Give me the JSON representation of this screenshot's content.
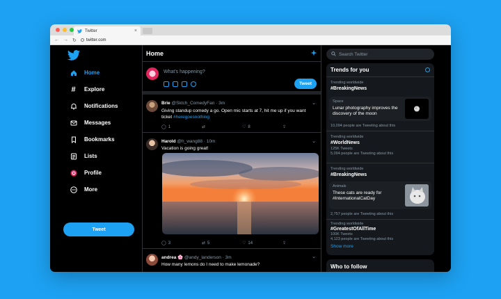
{
  "browser": {
    "tab_title": "Twitter",
    "url": "twitter.com",
    "dot_colors": [
      "#ff5f57",
      "#febc2e",
      "#28c840"
    ]
  },
  "nav": {
    "items": [
      {
        "label": "Home",
        "icon": "home-icon"
      },
      {
        "label": "Explore",
        "icon": "hashtag-icon"
      },
      {
        "label": "Notifications",
        "icon": "bell-icon"
      },
      {
        "label": "Messages",
        "icon": "envelope-icon"
      },
      {
        "label": "Bookmarks",
        "icon": "bookmark-icon"
      },
      {
        "label": "Lists",
        "icon": "list-icon"
      },
      {
        "label": "Profile",
        "icon": "profile-icon"
      },
      {
        "label": "More",
        "icon": "more-icon"
      }
    ],
    "tweet_button": "Tweet"
  },
  "feed": {
    "title": "Home",
    "composer": {
      "placeholder": "What's happening?",
      "button": "Tweet"
    },
    "tweets": [
      {
        "name": "Brie",
        "handle": "@Sktch_ComedyFan · 3m",
        "text": "Giving standup comedy a go. Open mic starts at 7, hit me up if you want ticket ",
        "hashtag": "#heregoesnothing",
        "replies": "1",
        "retweets": "",
        "likes": "8",
        "shares": ""
      },
      {
        "name": "Harold",
        "handle": "@h_wang88 · 10m",
        "text": "Vacation is going great!",
        "replies": "3",
        "retweets": "5",
        "likes": "14",
        "shares": ""
      },
      {
        "name": "andrea 🌸",
        "handle": "@andy_landerson · 3m",
        "text": "How many lemons do I need to make lemonade?"
      }
    ]
  },
  "sidebar": {
    "search_placeholder": "Search Twitter",
    "trends_title": "Trends for you",
    "trends": [
      {
        "context": "Trending worldwide",
        "name": "#BreakingNews"
      },
      {
        "card_context": "Space",
        "card_text": "Lunar photography improves the discovery of the moon",
        "count": "10,094 people are Tweeting about this"
      },
      {
        "context": "Trending worldwide",
        "name": "#WorldNews",
        "tweets": "125K Tweets",
        "count": "5,094 people are Tweeting about this"
      },
      {
        "context": "Trending worldwide",
        "name": "#BreakingNews"
      },
      {
        "card_context": "Animals",
        "card_text": "These cats are ready for #InternationalCatDay",
        "count": "2,757 people are Tweeting about this"
      },
      {
        "context": "Trending worldwide",
        "name": "#GreatestOfAllTime",
        "tweets": "100K Tweets",
        "count": "4,123 people are Tweeting about this"
      }
    ],
    "show_more": "Show more",
    "who_to_follow": "Who to follow"
  },
  "colors": {
    "accent": "#1da1f2",
    "background": "#000000",
    "panel": "#15181c"
  }
}
